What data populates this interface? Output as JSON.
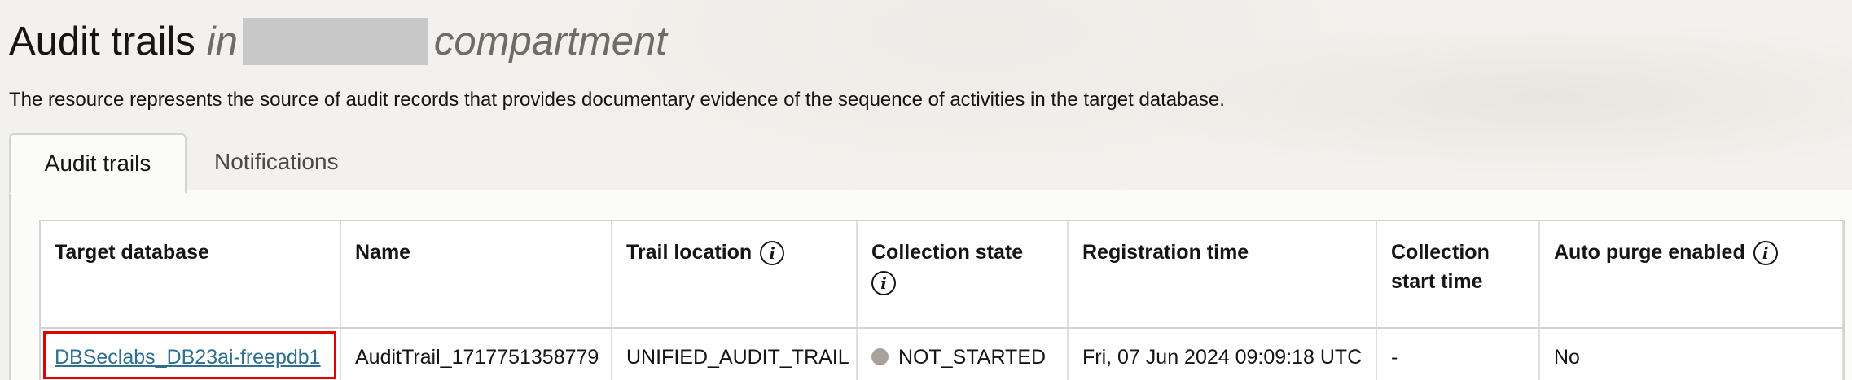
{
  "header": {
    "title_main": "Audit trails",
    "title_in": "in",
    "title_suffix": "compartment",
    "subtitle": "The resource represents the source of audit records that provides documentary evidence of the sequence of activities in the target database."
  },
  "tabs": [
    {
      "label": "Audit trails",
      "active": true
    },
    {
      "label": "Notifications",
      "active": false
    }
  ],
  "table": {
    "columns": [
      {
        "label": "Target database",
        "info": false
      },
      {
        "label": "Name",
        "info": false
      },
      {
        "label": "Trail location",
        "info": true
      },
      {
        "label": "Collection state",
        "info": true
      },
      {
        "label": "Registration time",
        "info": false
      },
      {
        "label": "Collection start time",
        "info": false
      },
      {
        "label": "Auto purge enabled",
        "info": true
      }
    ],
    "rows": [
      {
        "target_database": "DBSeclabs_DB23ai-freepdb1",
        "name": "AuditTrail_1717751358779",
        "trail_location": "UNIFIED_AUDIT_TRAIL",
        "collection_state": "NOT_STARTED",
        "registration_time": "Fri, 07 Jun 2024 09:09:18 UTC",
        "collection_start_time": "-",
        "auto_purge_enabled": "No"
      }
    ]
  },
  "icons": {
    "info": "info-icon",
    "status": "status-dot-icon"
  },
  "colors": {
    "link": "#2f6f8f",
    "highlight": "#e00000",
    "status_not_started": "#a7a39b",
    "redaction": "#c8c8c8"
  }
}
